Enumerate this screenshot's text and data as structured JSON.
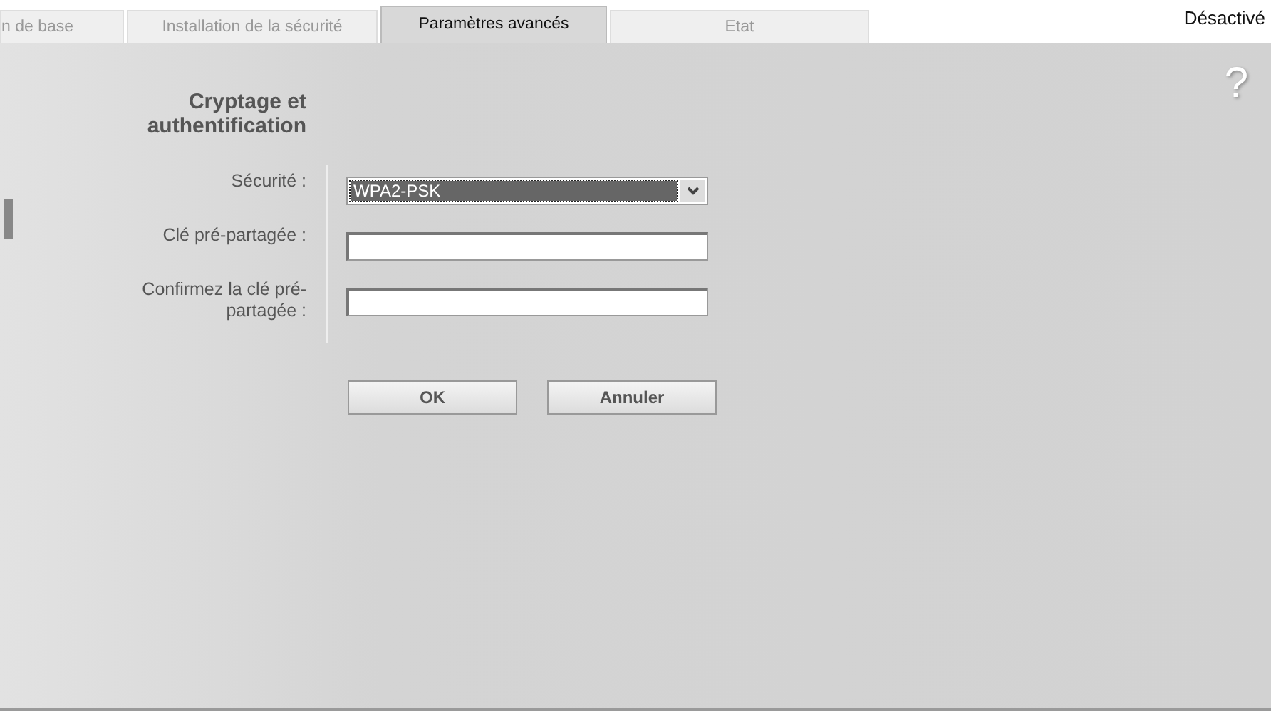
{
  "tabs": [
    {
      "label": "n de base",
      "selected": false
    },
    {
      "label": "Installation de la sécurité",
      "selected": false
    },
    {
      "label": "Paramètres avancés",
      "selected": true
    },
    {
      "label": "Etat",
      "selected": false
    }
  ],
  "status": "Désactivé",
  "help_icon": "?",
  "section_title": "Cryptage et authentification",
  "fields": [
    {
      "label": "Sécurité :",
      "kind": "select",
      "value": "WPA2-PSK"
    },
    {
      "label": "Clé pré-partagée :",
      "kind": "text"
    },
    {
      "label": "Confirmez la clé pré-partagée :",
      "kind": "text"
    }
  ],
  "buttons": [
    "OK",
    "Annuler"
  ]
}
